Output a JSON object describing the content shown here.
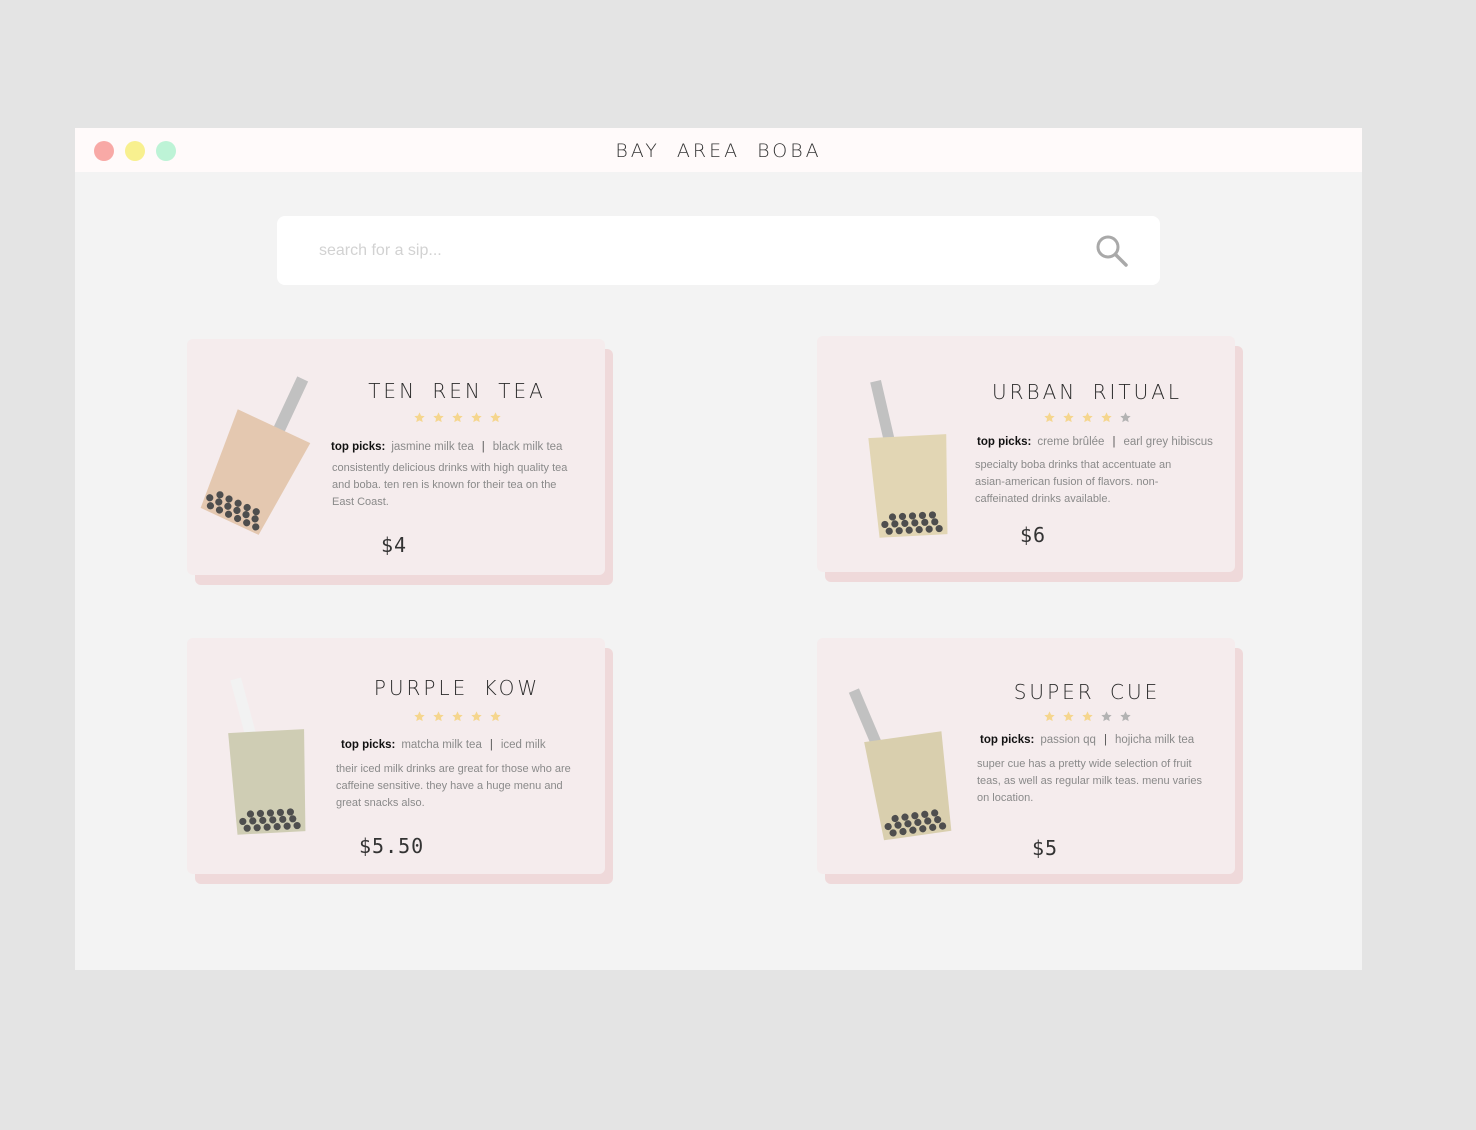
{
  "window": {
    "title": "BAY AREA BOBA",
    "controls": [
      "close",
      "minimize",
      "maximize"
    ]
  },
  "search": {
    "placeholder": "search for a sip...",
    "icon": "search-icon"
  },
  "colors": {
    "star_filled": "#f5d68e",
    "star_empty": "#b3b3b3",
    "card_bg": "#f5eced",
    "card_shadow": "#efd9da"
  },
  "cards": [
    {
      "name": "TEN REN TEA",
      "rating": 5,
      "picks_label": "top picks:",
      "pick1": "jasmine milk tea",
      "pick2": "black milk tea",
      "description": "consistently delicious drinks with high quality tea and boba. ten ren is known for their tea on the East Coast.",
      "price": "$4",
      "cup_color": "#e4c8b0"
    },
    {
      "name": "URBAN RITUAL",
      "rating": 4,
      "picks_label": "top picks:",
      "pick1": "creme brûlée",
      "pick2": "earl grey hibiscus",
      "description": "specialty boba drinks that accentuate an asian-american fusion of flavors. non-caffeinated drinks available.",
      "price": "$6",
      "cup_color": "#e2d6b4"
    },
    {
      "name": "PURPLE KOW",
      "rating": 5,
      "picks_label": "top picks:",
      "pick1": "matcha milk tea",
      "pick2": "iced milk",
      "description": "their iced milk drinks are great for those who are caffeine sensitive. they have a huge menu and great snacks also.",
      "price": "$5.50",
      "cup_color": "#cfcdb4"
    },
    {
      "name": "SUPER CUE",
      "rating": 3,
      "picks_label": "top picks:",
      "pick1": "passion qq",
      "pick2": "hojicha milk tea",
      "description": "super cue has a pretty wide selection of fruit teas, as well as regular milk teas. menu varies on location.",
      "price": "$5",
      "cup_color": "#d9cfae"
    }
  ]
}
